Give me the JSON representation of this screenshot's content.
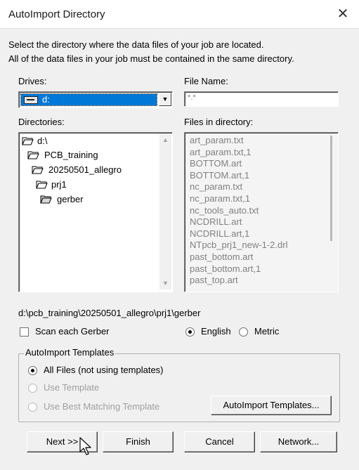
{
  "window": {
    "title": "AutoImport Directory",
    "close_glyph": "✕"
  },
  "instructions": {
    "line1": "Select the directory where the data files of your job are located.",
    "line2": "All of the data files in your job must be contained in the same directory."
  },
  "drives": {
    "label": "Drives:",
    "selected": "d:"
  },
  "file_name": {
    "label": "File Name:",
    "value": "*.*"
  },
  "directories": {
    "label": "Directories:",
    "items": [
      "d:\\",
      "PCB_training",
      "20250501_allegro",
      "prj1",
      "gerber"
    ]
  },
  "files": {
    "label": "Files in directory:",
    "items": [
      "art_param.txt",
      "art_param.txt,1",
      "BOTTOM.art",
      "BOTTOM.art,1",
      "nc_param.txt",
      "nc_param.txt,1",
      "nc_tools_auto.txt",
      "NCDRILL.art",
      "NCDRILL.art,1",
      "NTpcb_prj1_new-1-2.drl",
      "past_bottom.art",
      "past_bottom.art,1",
      "past_top.art"
    ]
  },
  "current_path": "d:\\pcb_training\\20250501_allegro\\prj1\\gerber",
  "options": {
    "scan_each_gerber": "Scan each Gerber",
    "english": "English",
    "metric": "Metric"
  },
  "templates": {
    "group_label": "AutoImport Templates",
    "all_files": "All Files (not using templates)",
    "use_template": "Use Template",
    "use_best": "Use Best Matching Template",
    "button": "AutoImport Templates..."
  },
  "buttons": {
    "next": "Next >>",
    "finish": "Finish",
    "cancel": "Cancel",
    "network": "Network..."
  }
}
